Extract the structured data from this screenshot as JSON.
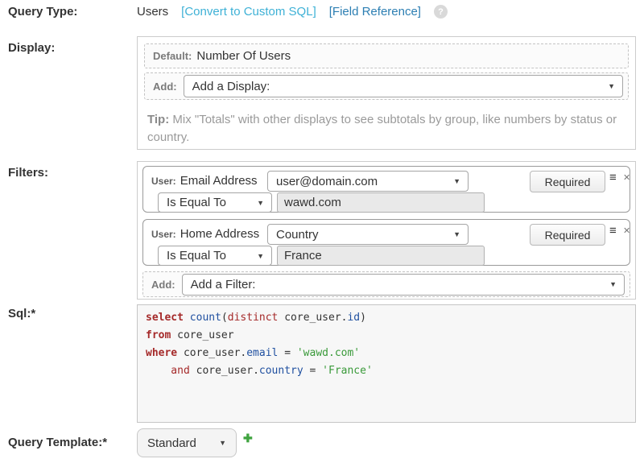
{
  "colors": {
    "link_cyan": "#3eb1d6",
    "link_blue": "#2d7fb3",
    "sql_keyword": "#a52a2a",
    "sql_identifier": "#2050a0",
    "sql_string": "#3a9a3a",
    "plus_green": "#3fa33f"
  },
  "icons": {
    "dropdown_arrow": "▼",
    "drag_handle": "≡",
    "remove": "✕",
    "help": "?",
    "add_plus": "✚"
  },
  "query_type": {
    "label": "Query Type:",
    "value": "Users",
    "convert_link": "[Convert to Custom SQL]",
    "field_reference_link": "[Field Reference]"
  },
  "display": {
    "label": "Display:",
    "default_label": "Default:",
    "default_value": "Number Of Users",
    "add_label": "Add:",
    "add_select_value": "Add a Display:",
    "tip_label": "Tip:",
    "tip_text": " Mix \"Totals\" with other displays to see subtotals by group, like numbers by status or country."
  },
  "filters": {
    "label": "Filters:",
    "add_label": "Add:",
    "add_select_value": "Add a Filter:",
    "items": [
      {
        "entity_label": "User:",
        "group": "Email Address",
        "field_select_value": "user@domain.com",
        "operator_select_value": "Is Equal To",
        "value": "wawd.com",
        "required_label": "Required"
      },
      {
        "entity_label": "User:",
        "group": "Home Address",
        "field_select_value": "Country",
        "operator_select_value": "Is Equal To",
        "value": "France",
        "required_label": "Required"
      }
    ]
  },
  "sql": {
    "label": "Sql:*",
    "text": "select count(distinct core_user.id)\nfrom core_user\nwhere core_user.email = 'wawd.com'\n    and core_user.country = 'France'",
    "lines": [
      [
        {
          "t": "select",
          "c": "kw"
        },
        {
          "t": " "
        },
        {
          "t": "count",
          "c": "id"
        },
        {
          "t": "("
        },
        {
          "t": "distinct",
          "c": "kw2"
        },
        {
          "t": " core_user."
        },
        {
          "t": "id",
          "c": "id"
        },
        {
          "t": ")"
        }
      ],
      [
        {
          "t": "from",
          "c": "kw"
        },
        {
          "t": " core_user"
        }
      ],
      [
        {
          "t": "where",
          "c": "kw"
        },
        {
          "t": " core_user."
        },
        {
          "t": "email",
          "c": "id"
        },
        {
          "t": " = "
        },
        {
          "t": "'wawd.com'",
          "c": "str"
        }
      ],
      [
        {
          "t": "    and",
          "c": "kw2"
        },
        {
          "t": " core_user."
        },
        {
          "t": "country",
          "c": "id"
        },
        {
          "t": " = "
        },
        {
          "t": "'France'",
          "c": "str"
        }
      ]
    ]
  },
  "query_template": {
    "label": "Query Template:*",
    "select_value": "Standard"
  }
}
